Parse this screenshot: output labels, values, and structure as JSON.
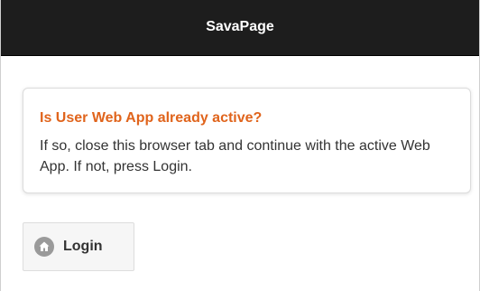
{
  "header": {
    "title": "SavaPage"
  },
  "notice": {
    "title": "Is User Web App already active?",
    "body": "If so, close this browser tab and continue with the active Web App. If not, press Login."
  },
  "login_button": {
    "label": "Login",
    "icon": "home-icon"
  },
  "colors": {
    "header_bg": "#1d1d1d",
    "notice_title": "#e0641c"
  }
}
